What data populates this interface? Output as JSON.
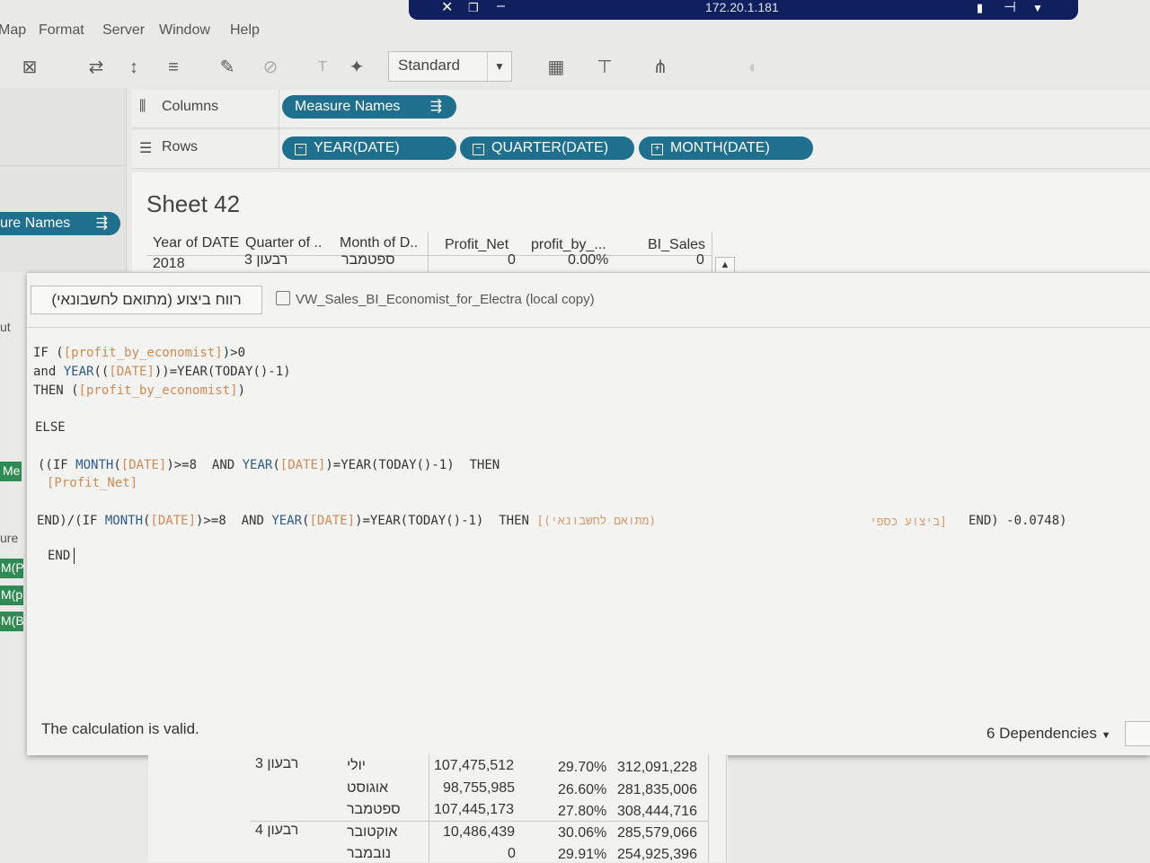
{
  "window": {
    "ip": "172.20.1.181"
  },
  "menu": [
    "Map",
    "Format",
    "Server",
    "Window",
    "Help"
  ],
  "toolbar": {
    "view_mode": "Standard"
  },
  "shelves": {
    "columns_label": "Columns",
    "rows_label": "Rows",
    "columns_pills": [
      "Measure Names"
    ],
    "rows_pills": [
      "YEAR(DATE)",
      "QUARTER(DATE)",
      "MONTH(DATE)"
    ]
  },
  "left_panel": {
    "pill": "ure Names",
    "fragments": [
      "ut",
      "Me",
      "ure",
      "M(P",
      "M(p",
      "M(B"
    ]
  },
  "sheet": {
    "title": "Sheet 42",
    "headers": [
      "Year of DATE",
      "Quarter of ..",
      "Month of D..",
      "Profit_Net",
      "profit_by_...",
      "BI_Sales"
    ],
    "first_row": [
      "2018",
      "רבעון 3",
      "ספטמבר",
      "0",
      "0.00%",
      "0"
    ]
  },
  "calc": {
    "name": "רווח ביצוע (מתואם לחשבונאי)",
    "source": "VW_Sales_BI_Economist_for_Electra (local copy)",
    "status": "The calculation is valid.",
    "dependencies": "6 Dependencies",
    "code": {
      "l1_kw": "IF (",
      "l1_field": "[profit_by_economist]",
      "l1_end": ")>0",
      "l2_kw": "and ",
      "l2_fn": "YEAR",
      "l2_a": "((",
      "l2_field": "[DATE]",
      "l2_b": "))=YEAR(TODAY()-1)",
      "l3_kw": "THEN (",
      "l3_field": "[profit_by_economist]",
      "l3_end": ")",
      "else": "ELSE",
      "l5_a": "((IF ",
      "l5_fn": "MONTH",
      "l5_b": "(",
      "l5_field": "[DATE]",
      "l5_c": ")>=8  AND ",
      "l5_fn2": "YEAR",
      "l5_d": "(",
      "l5_field2": "[DATE]",
      "l5_e": ")=YEAR(TODAY()-1)  THEN",
      "l6_field": "[Profit_Net]",
      "l7_a": "END)/(IF ",
      "l7_fn": "MONTH",
      "l7_b": "(",
      "l7_field": "[DATE]",
      "l7_c": ")>=8  AND ",
      "l7_fn2": "YEAR",
      "l7_d": "(",
      "l7_field2": "[DATE]",
      "l7_e": ")=YEAR(TODAY()-1)  THEN ",
      "l7_heb": "[(מתואם לחשבונאי)",
      "l7_heb2": "ביצוע כספי]",
      "l7_end": "END) -0.0748)",
      "end": "END"
    }
  },
  "lower_table": {
    "rows": [
      {
        "quarter": "רבעון 3",
        "month": "יולי",
        "profit_net": "107,475,512",
        "pct": "29.70%",
        "sales": "312,091,228"
      },
      {
        "quarter": "",
        "month": "אוגוסט",
        "profit_net": "98,755,985",
        "pct": "26.60%",
        "sales": "281,835,006"
      },
      {
        "quarter": "",
        "month": "ספטמבר",
        "profit_net": "107,445,173",
        "pct": "27.80%",
        "sales": "308,444,716"
      },
      {
        "quarter": "רבעון 4",
        "month": "אוקטובר",
        "profit_net": "10,486,439",
        "pct": "30.06%",
        "sales": "285,579,066"
      },
      {
        "quarter": "",
        "month": "נובמבר",
        "profit_net": "0",
        "pct": "29.91%",
        "sales": "254,925,396"
      }
    ]
  }
}
